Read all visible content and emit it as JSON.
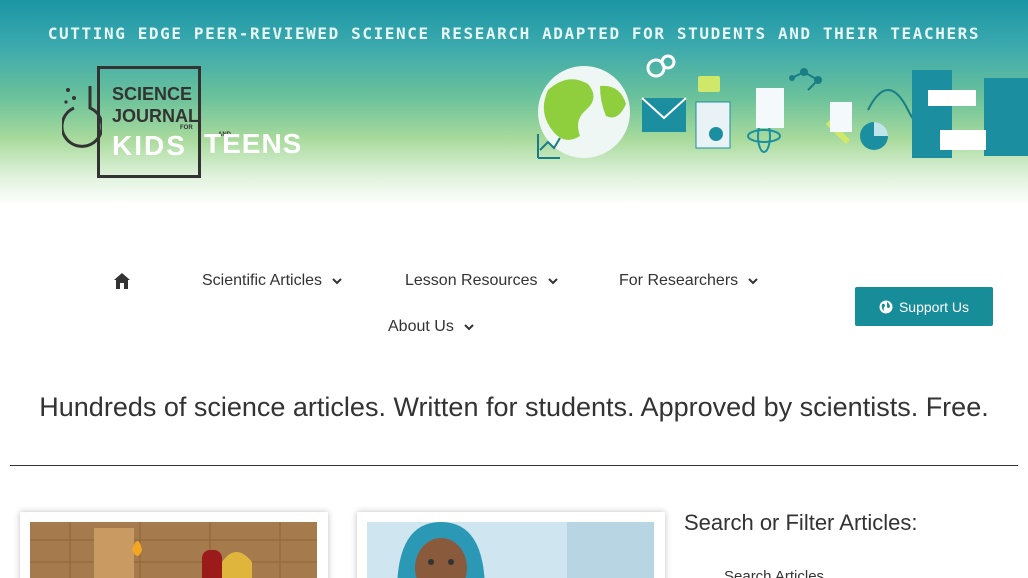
{
  "colors": {
    "accent": "#168d99",
    "banner_top": "#1b96a6",
    "banner_mid": "#6cc29b",
    "text": "#333333"
  },
  "banner": {
    "tagline": "CUTTING EDGE PEER-REVIEWED SCIENCE RESEARCH ADAPTED FOR STUDENTS AND THEIR TEACHERS",
    "logo": {
      "line1": "SCIENCE",
      "line2": "JOURNAL",
      "for": "FOR",
      "kids": "KIDS",
      "and": "AND",
      "teens": "TEENS"
    }
  },
  "nav": {
    "home_icon": "home-icon",
    "items": [
      {
        "label": "Scientific Articles"
      },
      {
        "label": "Lesson Resources"
      },
      {
        "label": "For Researchers"
      },
      {
        "label": "About Us"
      }
    ]
  },
  "support_button": {
    "label": "Support Us",
    "icon": "globe-icon"
  },
  "headline": "Hundreds of science articles. Written for students. Approved by scientists. Free.",
  "sidebar": {
    "title": "Search or Filter Articles:",
    "sub": "Search Articles"
  }
}
